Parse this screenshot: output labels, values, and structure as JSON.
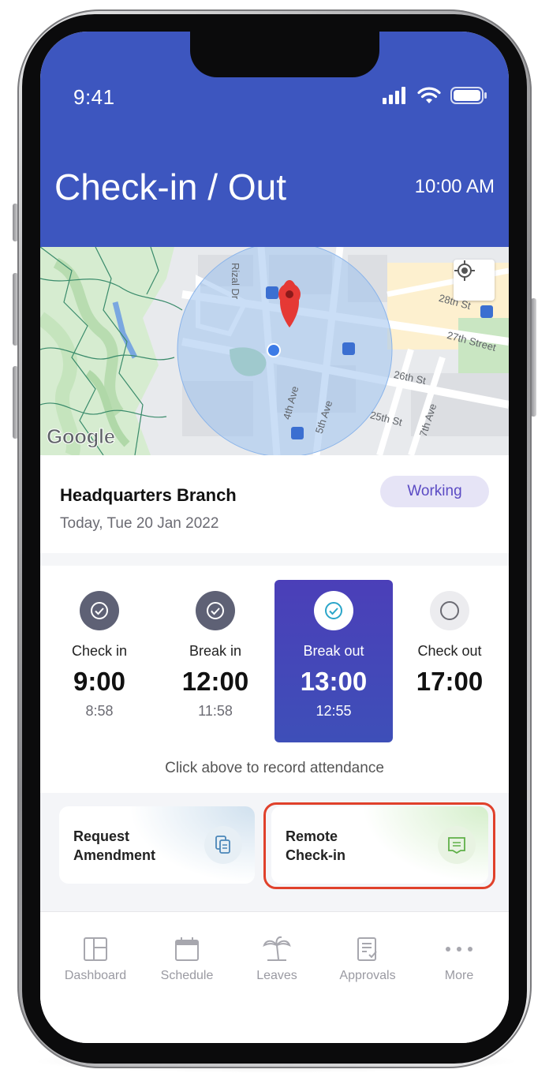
{
  "status_bar": {
    "time": "9:41"
  },
  "header": {
    "title": "Check-in / Out",
    "clock": "10:00 AM"
  },
  "map": {
    "logo": "Google",
    "streets": [
      "Rizal Dr",
      "28th St",
      "27th Street",
      "26th St",
      "25th St",
      "4th Ave",
      "5th Ave",
      "7th Ave"
    ]
  },
  "branch": {
    "name": "Headquarters Branch",
    "date": "Today, Tue 20 Jan 2022",
    "status": "Working"
  },
  "attendance": {
    "slots": [
      {
        "label": "Check in",
        "time": "9:00",
        "actual": "8:58",
        "state": "done"
      },
      {
        "label": "Break in",
        "time": "12:00",
        "actual": "11:58",
        "state": "done"
      },
      {
        "label": "Break out",
        "time": "13:00",
        "actual": "12:55",
        "state": "active"
      },
      {
        "label": "Check out",
        "time": "17:00",
        "actual": "",
        "state": "pending"
      }
    ],
    "hint": "Click above to record attendance"
  },
  "actions": {
    "request": {
      "line1": "Request",
      "line2": "Amendment"
    },
    "remote": {
      "line1": "Remote",
      "line2": "Check-in"
    }
  },
  "nav": {
    "items": [
      "Dashboard",
      "Schedule",
      "Leaves",
      "Approvals",
      "More"
    ]
  },
  "colors": {
    "header": "#3d56bf",
    "active_slot": "#4b3fb8",
    "badge_text": "#5b4bc4",
    "highlight": "#e0412b"
  }
}
